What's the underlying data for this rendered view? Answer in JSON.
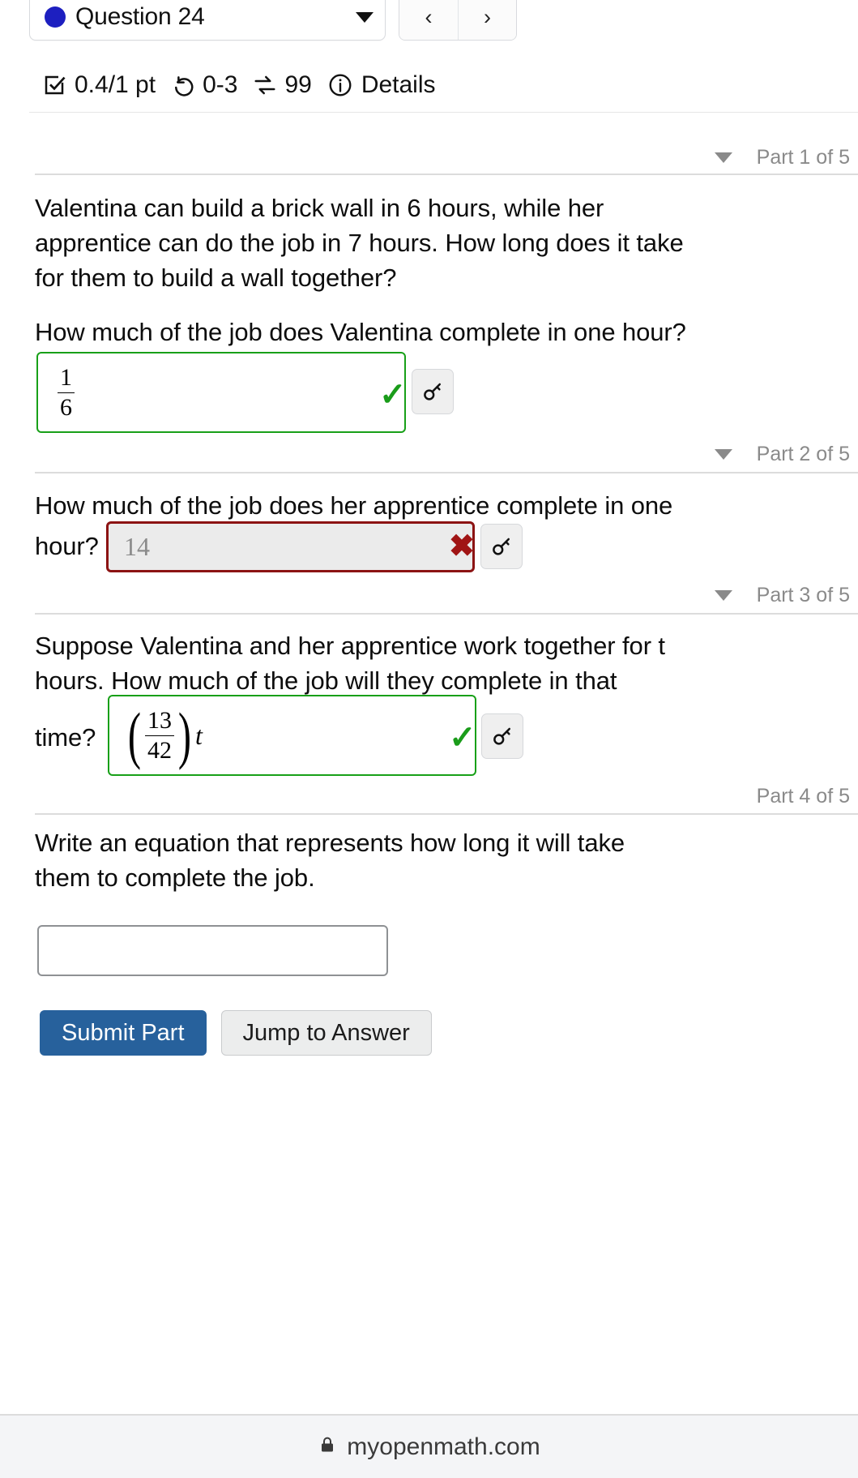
{
  "header": {
    "question_label": "Question 24",
    "dropdown_caret_icon": "chevron-down-icon",
    "prev_label": "‹",
    "next_label": "›",
    "score": "0.4/1 pt",
    "attempts": "0-3",
    "reattempts": "99",
    "details_label": "Details",
    "checkbox_icon": "checkbox-check-icon",
    "undo_icon": "undo-arrow-icon",
    "swap_icon": "swap-arrows-icon",
    "info_icon": "info-circle-icon"
  },
  "parts": [
    {
      "label": "Part 1 of 5",
      "has_toggle": true,
      "prompt_lines": [
        "Valentina can build a brick wall in 6 hours, while her",
        "apprentice can do the job in 7 hours. How long does it take",
        "for them to build a wall together?"
      ],
      "question": "How much of the job does Valentina complete in one hour?",
      "answer": {
        "numerator": "1",
        "denominator": "6"
      },
      "status": "correct",
      "status_icon": "check-mark-icon",
      "key_icon": "key-icon"
    },
    {
      "label": "Part 2 of 5",
      "has_toggle": true,
      "question_line1": "How much of the job does her apprentice complete in one",
      "question_line2": "hour?",
      "answer_value": "14",
      "status": "incorrect",
      "status_icon": "x-mark-icon",
      "key_icon": "key-icon"
    },
    {
      "label": "Part 3 of 5",
      "has_toggle": true,
      "question_line1": "Suppose Valentina and her apprentice work together for t",
      "question_line2": "hours. How much of the job will they complete in that",
      "question_line3": "time?",
      "answer": {
        "numerator": "13",
        "denominator": "42",
        "variable": "t"
      },
      "status": "correct",
      "status_icon": "check-mark-icon",
      "key_icon": "key-icon"
    },
    {
      "label": "Part 4 of 5",
      "has_toggle": false,
      "question_line1": "Write an equation that represents how long it will take",
      "question_line2": "them to complete the job.",
      "answer_value": "",
      "status": "empty"
    }
  ],
  "actions": {
    "submit_label": "Submit Part",
    "jump_label": "Jump to Answer"
  },
  "footer": {
    "lock_icon": "lock-icon",
    "url": "myopenmath.com"
  },
  "colors": {
    "accent_blue": "#27619c",
    "dot_blue": "#1d1fc0",
    "correct_green": "#18a018",
    "incorrect_red": "#8c1313",
    "muted_gray": "#8a8a8a"
  }
}
